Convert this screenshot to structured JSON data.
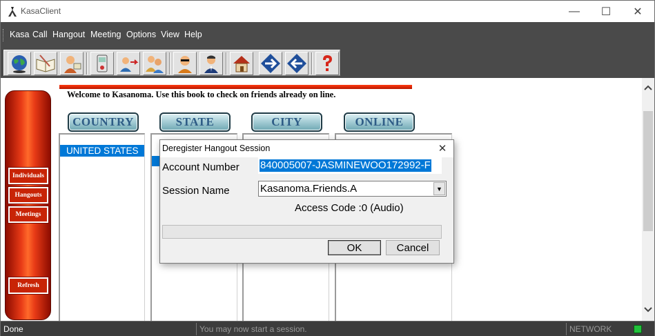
{
  "window": {
    "title": "KasaClient",
    "controls": {
      "minimize": "—",
      "maximize": "☐",
      "close": "✕"
    }
  },
  "menu": [
    "Kasa",
    "Call",
    "Hangout",
    "Meeting",
    "Options",
    "View",
    "Help"
  ],
  "toolbar": {
    "buttons": [
      "globe-icon",
      "open-book-icon",
      "contact-card-icon",
      "phone-icon",
      "user-transfer-icon",
      "group-users-icon",
      "sunglasses-person-icon",
      "person-suit-icon",
      "home-icon",
      "arrow-right-icon",
      "arrow-left-icon",
      "help-question-icon"
    ]
  },
  "sidebar": {
    "buttons": [
      "Individuals",
      "Hangouts",
      "Meetings",
      "Refresh"
    ]
  },
  "main": {
    "welcome": "Welcome to Kasanoma. Use this book to check on friends already on line.",
    "columns": [
      "COUNTRY",
      "STATE",
      "CITY",
      "ONLINE"
    ],
    "country_list": [
      "UNITED STATES"
    ]
  },
  "dialog": {
    "title": "Deregister Hangout Session",
    "close": "✕",
    "account_label": "Account Number",
    "account_value": "840005007-JASMINEWOO172992-F",
    "session_label": "Session Name",
    "session_value": "Kasanoma.Friends.A",
    "access_code": "Access Code :0 (Audio)",
    "progress": 0,
    "ok": "OK",
    "cancel": "Cancel"
  },
  "statusbar": {
    "left": "Done",
    "message": "You may now start a session.",
    "network": "NETWORK",
    "network_led_color": "#21c23b"
  },
  "scrollbar": {
    "up": "⌃",
    "down": "⌄"
  },
  "colors": {
    "selection": "#0078d7",
    "accent_red": "#e83a16",
    "dark_bar": "#4a4a4a"
  }
}
